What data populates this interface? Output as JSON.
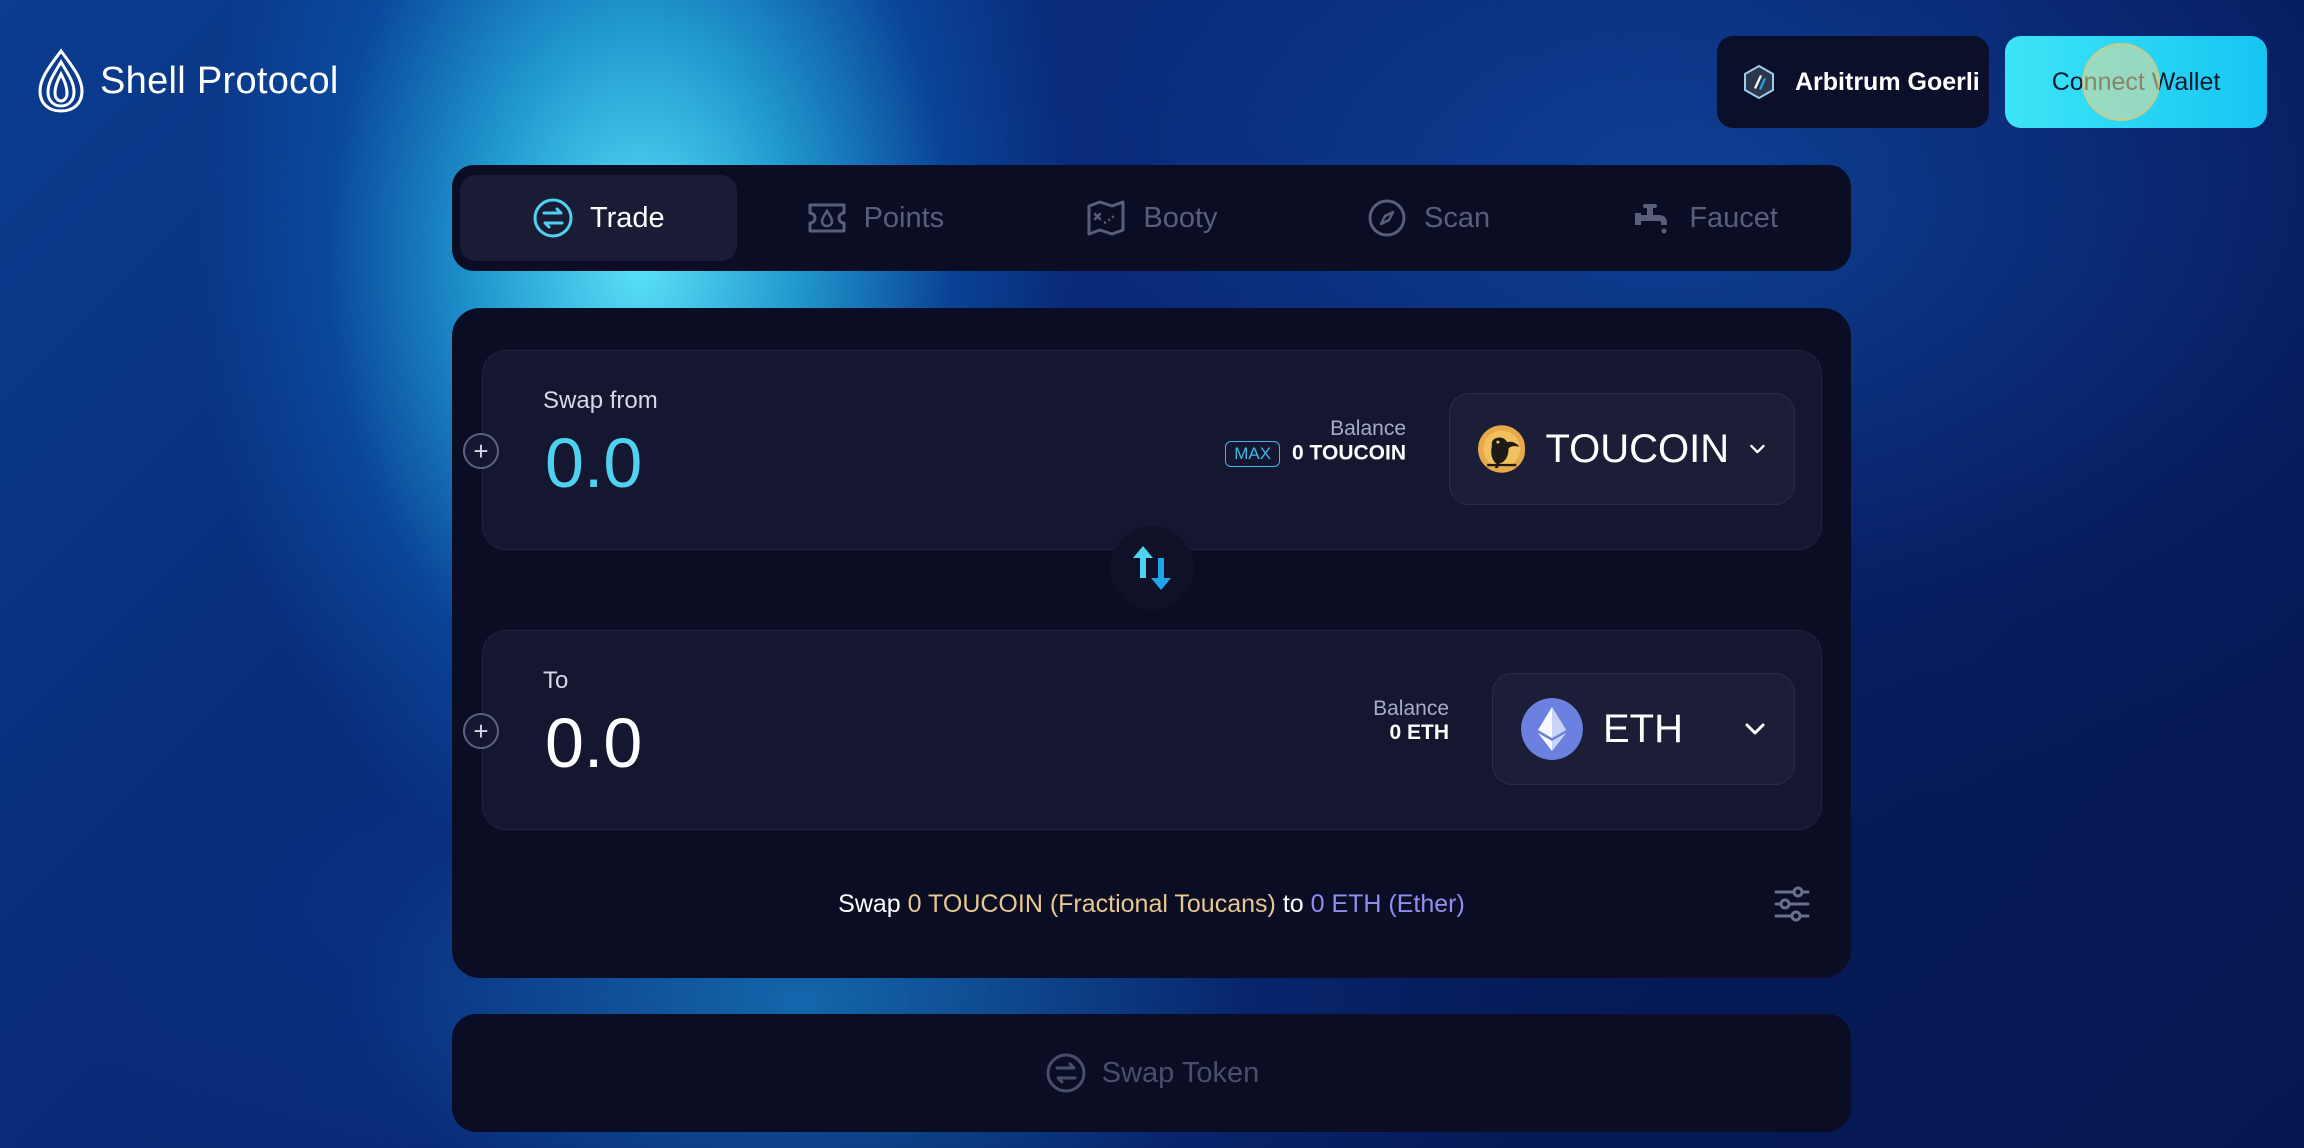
{
  "header": {
    "logo_text": "Shell Protocol",
    "network_label": "Arbitrum Goerli",
    "connect_label": "Connect Wallet"
  },
  "nav": {
    "tabs": [
      {
        "label": "Trade",
        "icon": "trade-icon",
        "active": true
      },
      {
        "label": "Points",
        "icon": "ticket-icon",
        "active": false
      },
      {
        "label": "Booty",
        "icon": "treasure-map-icon",
        "active": false
      },
      {
        "label": "Scan",
        "icon": "compass-icon",
        "active": false
      },
      {
        "label": "Faucet",
        "icon": "faucet-icon",
        "active": false
      }
    ]
  },
  "swap_from": {
    "label": "Swap from",
    "amount": "0.0",
    "balance_label": "Balance",
    "max_label": "MAX",
    "balance_value": "0 TOUCOIN",
    "token": "TOUCOIN"
  },
  "swap_to": {
    "label": "To",
    "amount": "0.0",
    "balance_label": "Balance",
    "balance_value": "0 ETH",
    "token": "ETH"
  },
  "summary": {
    "prefix": "Swap",
    "from_part": "0 TOUCOIN (Fractional Toucans)",
    "middle": "to",
    "to_part": "0 ETH (Ether)"
  },
  "action": {
    "swap_label": "Swap Token"
  },
  "colors": {
    "accent_cyan": "#4fd2ef",
    "connect_button": "#3ee4f7",
    "toucoin_text": "#e8c790",
    "eth_text": "#8f8ff2",
    "card_bg": "#0b0d25"
  }
}
